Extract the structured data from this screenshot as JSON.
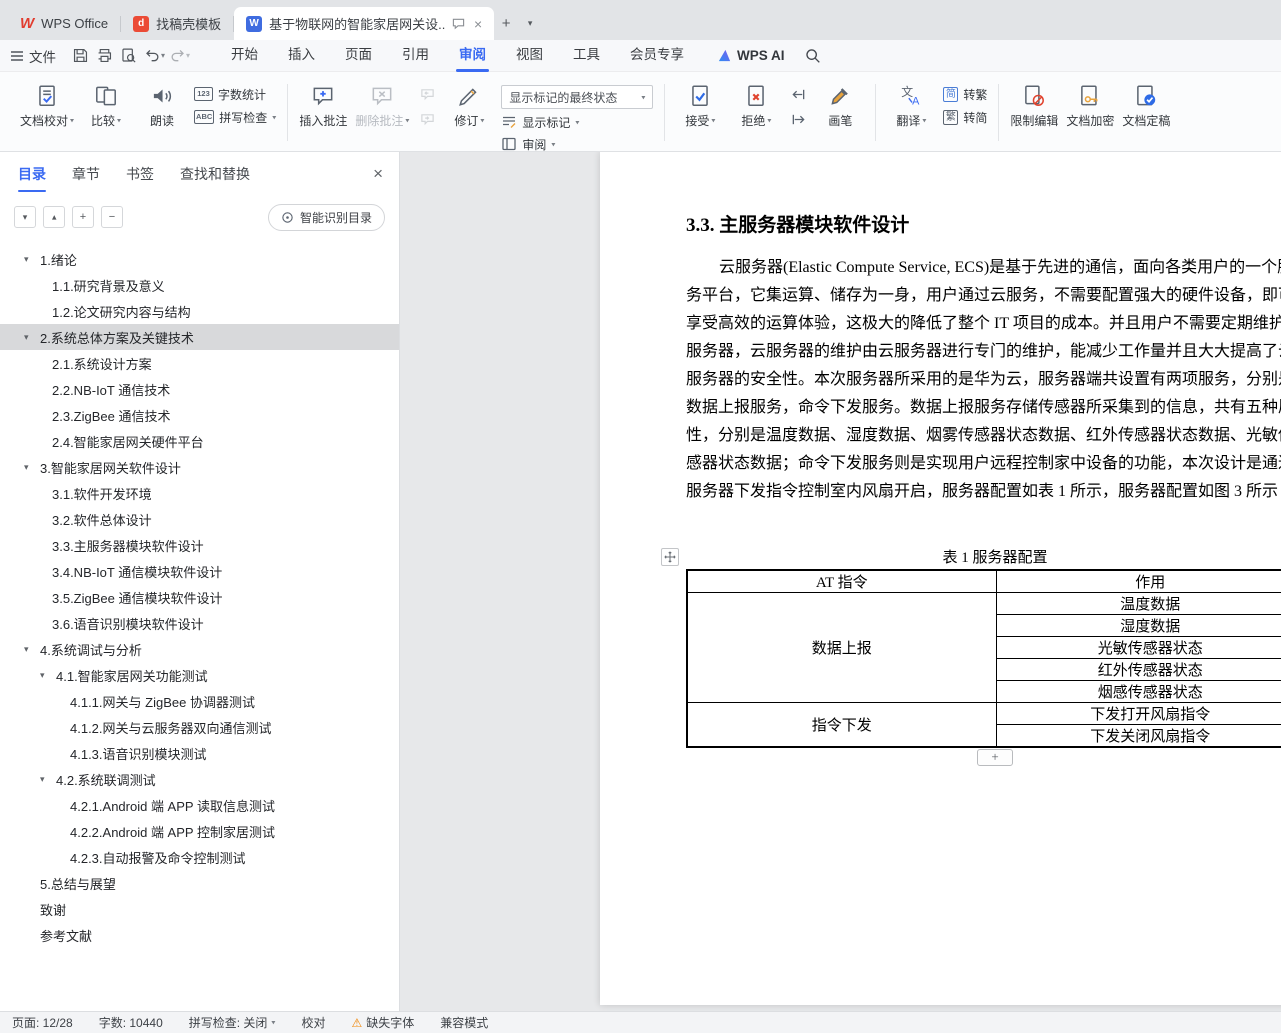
{
  "colors": {
    "accent_blue": "#3a6af2",
    "wps_red": "#e13c2f",
    "doc_icon_blue": "#3f6ce0",
    "docer_orange": "#eb4b36",
    "warning_orange": "#f08300",
    "toc_selected_gray": "#d8d9db"
  },
  "titlebar": {
    "tabs": [
      {
        "label": "WPS Office"
      },
      {
        "label": "找稿壳模板"
      },
      {
        "label": "基于物联网的智能家居网关设...",
        "active": true
      }
    ]
  },
  "menubar": {
    "file": "文件",
    "tabs": [
      "开始",
      "插入",
      "页面",
      "引用",
      "审阅",
      "视图",
      "工具",
      "会员专享"
    ],
    "wps_ai": "WPS AI"
  },
  "ribbon": {
    "doc_proof": "文档校对",
    "compare": "比较",
    "read_aloud": "朗读",
    "word_count": "字数统计",
    "word_count_badge": "123",
    "spell_check": "拼写检查",
    "spell_badge": "ABC",
    "insert_comment": "插入批注",
    "delete_comment": "删除批注",
    "track_changes": "修订",
    "markup_state": "显示标记的最终状态",
    "show_markup": "显示标记",
    "review": "审阅",
    "accept": "接受",
    "reject": "拒绝",
    "pen": "画笔",
    "translate": "翻译",
    "simp_badge": "简",
    "trad_badge": "繁",
    "to_trad": "转繁",
    "to_simp": "转简",
    "restrict_edit": "限制编辑",
    "encrypt": "文档加密",
    "finalize": "文档定稿"
  },
  "sidebar": {
    "tabs": [
      "目录",
      "章节",
      "书签",
      "查找和替换"
    ],
    "smart_toc": "智能识别目录",
    "toc": [
      {
        "label": "1.绪论",
        "level": 1,
        "parent": true
      },
      {
        "label": "1.1.研究背景及意义",
        "level": 2
      },
      {
        "label": "1.2.论文研究内容与结构",
        "level": 2
      },
      {
        "label": "2.系统总体方案及关键技术",
        "level": 1,
        "parent": true,
        "selected": true
      },
      {
        "label": "2.1.系统设计方案",
        "level": 2
      },
      {
        "label": "2.2.NB-IoT 通信技术",
        "level": 2
      },
      {
        "label": "2.3.ZigBee 通信技术",
        "level": 2
      },
      {
        "label": "2.4.智能家居网关硬件平台",
        "level": 2
      },
      {
        "label": "3.智能家居网关软件设计",
        "level": 1,
        "parent": true
      },
      {
        "label": "3.1.软件开发环境",
        "level": 2
      },
      {
        "label": "3.2.软件总体设计",
        "level": 2
      },
      {
        "label": "3.3.主服务器模块软件设计",
        "level": 2
      },
      {
        "label": "3.4.NB-IoT 通信模块软件设计",
        "level": 2
      },
      {
        "label": "3.5.ZigBee 通信模块软件设计",
        "level": 2
      },
      {
        "label": "3.6.语音识别模块软件设计",
        "level": 2
      },
      {
        "label": "4.系统调试与分析",
        "level": 1,
        "parent": true
      },
      {
        "label": "4.1.智能家居网关功能测试",
        "level": 2,
        "parent": true
      },
      {
        "label": "4.1.1.网关与 ZigBee 协调器测试",
        "level": 3
      },
      {
        "label": "4.1.2.网关与云服务器双向通信测试",
        "level": 3
      },
      {
        "label": "4.1.3.语音识别模块测试",
        "level": 3
      },
      {
        "label": "4.2.系统联调测试",
        "level": 2,
        "parent": true
      },
      {
        "label": "4.2.1.Android 端 APP 读取信息测试",
        "level": 3
      },
      {
        "label": "4.2.2.Android 端 APP 控制家居测试",
        "level": 3
      },
      {
        "label": "4.2.3.自动报警及命令控制测试",
        "level": 3
      },
      {
        "label": "5.总结与展望",
        "level": 1
      },
      {
        "label": "致谢",
        "level": 1
      },
      {
        "label": "参考文献",
        "level": 1
      }
    ]
  },
  "document": {
    "heading": "3.3. 主服务器模块软件设计",
    "paragraph_lines": [
      "云服务器(Elastic Compute Service, ECS)是基于先进的通信，面向各类用户的一个服",
      "务平台，它集运算、储存为一身，用户通过云服务，不需要配置强大的硬件设备，即可",
      "享受高效的运算体验，这极大的降低了整个 IT 项目的成本。并且用户不需要定期维护",
      "服务器，云服务器的维护由云服务器进行专门的维护，能减少工作量并且大大提高了云",
      "服务器的安全性。本次服务器所采用的是华为云，服务器端共设置有两项服务，分别是",
      "数据上报服务，命令下发服务。数据上报服务存储传感器所采集到的信息，共有五种属",
      "性，分别是温度数据、湿度数据、烟雾传感器状态数据、红外传感器状态数据、光敏传",
      "感器状态数据；命令下发服务则是实现用户远程控制家中设备的功能，本次设计是通过",
      "服务器下发指令控制室内风扇开启，服务器配置如表 1 所示，服务器配置如图 3 所示"
    ],
    "table": {
      "caption": "表 1 服务器配置",
      "col_headers": [
        "AT 指令",
        "作用"
      ],
      "groups": [
        {
          "name": "数据上报",
          "rows": [
            "温度数据",
            "湿度数据",
            "光敏传感器状态",
            "红外传感器状态",
            "烟感传感器状态"
          ]
        },
        {
          "name": "指令下发",
          "rows": [
            "下发打开风扇指令",
            "下发关闭风扇指令"
          ]
        }
      ]
    },
    "add_row": "+"
  },
  "statusbar": {
    "page": "页面: 12/28",
    "words": "字数: 10440",
    "spell": "拼写检查: 关闭",
    "proof": "校对",
    "missing_font": "缺失字体",
    "compat": "兼容模式"
  }
}
